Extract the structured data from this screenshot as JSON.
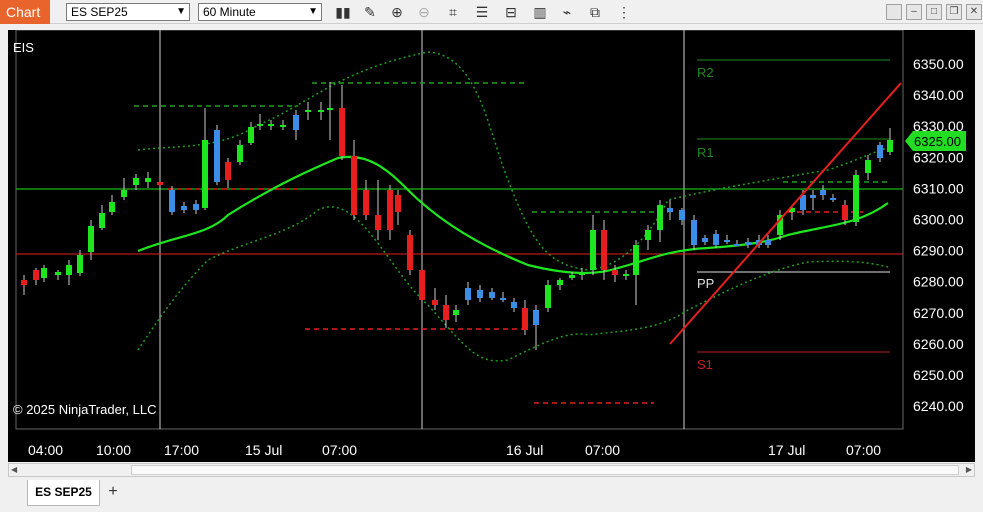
{
  "app": {
    "tab_label": "Chart",
    "instrument": "ES SEP25",
    "interval": "60 Minute",
    "bottom_tab": "ES SEP25",
    "add_tab": "+",
    "accent": "#e8642c"
  },
  "toolbar_icons": [
    "bars-icon",
    "pencil-icon",
    "zoom-in-icon",
    "zoom-out-icon",
    "crosshair-icon",
    "properties-icon",
    "strategies-icon",
    "data-box-icon",
    "chart-trader-icon",
    "screenshot-icon",
    "more-icon"
  ],
  "chart": {
    "symbol_label": "EIS",
    "copyright": "© 2025 NinjaTrader, LLC",
    "current_price": "6325.00",
    "price_ticks": [
      "6350.00",
      "6340.00",
      "6330.00",
      "6320.00",
      "6310.00",
      "6300.00",
      "6290.00",
      "6280.00",
      "6270.00",
      "6260.00",
      "6250.00",
      "6240.00"
    ],
    "time_ticks": [
      "04:00",
      "10:00",
      "17:00",
      "15 Jul",
      "07:00",
      "16 Jul",
      "07:00",
      "17 Jul",
      "07:00"
    ],
    "pivot_labels": {
      "r2": "R2",
      "r1": "R1",
      "pp": "PP",
      "s1": "S1"
    },
    "colors": {
      "up": "#1ee61e",
      "down": "#e61e1e",
      "neutral": "#3a8ee6",
      "r_level": "#1e8c1e",
      "s_level": "#b81e1e"
    }
  }
}
